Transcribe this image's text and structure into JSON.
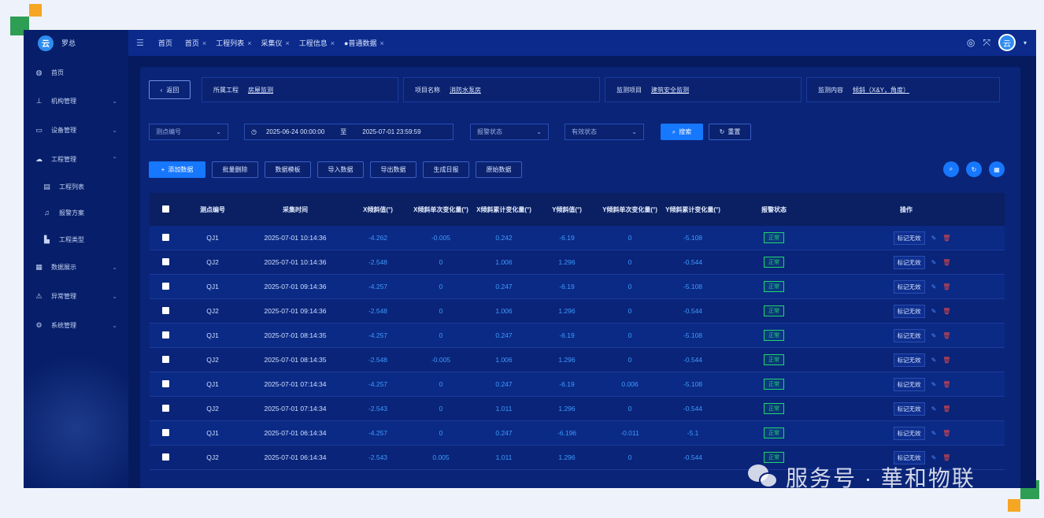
{
  "app": {
    "user": "罗总",
    "logo_text": "云"
  },
  "sidebar": {
    "items": [
      {
        "label": "首页",
        "icon": "dashboard-icon",
        "glyph": "◍",
        "chev": ""
      },
      {
        "label": "机构管理",
        "icon": "org-icon",
        "glyph": "⊥",
        "chev": "⌄"
      },
      {
        "label": "设备管理",
        "icon": "monitor-icon",
        "glyph": "▭",
        "chev": "⌄"
      },
      {
        "label": "工程管理",
        "icon": "cloud-icon",
        "glyph": "☁",
        "chev": "⌃"
      },
      {
        "label": "工程列表",
        "icon": "list-icon",
        "glyph": "▤",
        "chev": ""
      },
      {
        "label": "报警方案",
        "icon": "bell-icon",
        "glyph": "♫",
        "chev": ""
      },
      {
        "label": "工程类型",
        "icon": "building-icon",
        "glyph": "▙",
        "chev": ""
      },
      {
        "label": "数据展示",
        "icon": "table-icon",
        "glyph": "▦",
        "chev": "⌄"
      },
      {
        "label": "异常管理",
        "icon": "warning-icon",
        "glyph": "⚠",
        "chev": "⌄"
      },
      {
        "label": "系统管理",
        "icon": "gear-icon",
        "glyph": "⚙",
        "chev": "⌄"
      }
    ]
  },
  "topbar": {
    "tabs": [
      {
        "label": "首页",
        "close": ""
      },
      {
        "label": "首页",
        "close": "×"
      },
      {
        "label": "工程列表",
        "close": "×"
      },
      {
        "label": "采集仪",
        "close": "×"
      },
      {
        "label": "工程信息",
        "close": "×"
      },
      {
        "label": "●普通数据",
        "close": "×"
      }
    ]
  },
  "info": {
    "back": "返回",
    "project_label": "所属工程",
    "project_value": "房屋监测",
    "item_label": "项目名称",
    "item_value": "消防水泵房",
    "monitor_label": "监测项目",
    "monitor_value": "建筑安全监测",
    "content_label": "监测内容",
    "content_value": "倾斜（X&Y，角度）"
  },
  "filters": {
    "point_placeholder": "测点编号",
    "date_start": "2025-06-24 00:00:00",
    "date_sep": "至",
    "date_end": "2025-07-01 23:59:59",
    "alarm_placeholder": "报警状态",
    "valid_placeholder": "有效状态",
    "search": "搜索",
    "reset": "重置"
  },
  "actions": {
    "add": "添加数据",
    "batch_delete": "批量删除",
    "template": "数据模板",
    "import": "导入数据",
    "export": "导出数据",
    "daily": "生成日报",
    "raw": "原始数据"
  },
  "table": {
    "headers": {
      "point": "测点编号",
      "time": "采集时间",
      "x": "X倾斜值(°)",
      "x_single": "X倾斜单次变化量(°)",
      "x_total": "X倾斜累计变化量(°)",
      "y": "Y倾斜值(°)",
      "y_single": "Y倾斜单次变化量(°)",
      "y_total": "Y倾斜累计变化量(°)",
      "alarm": "报警状态",
      "ops": "操作"
    },
    "status_text": "正常",
    "mark_invalid": "标记无效",
    "rows": [
      {
        "point": "QJ1",
        "time": "2025-07-01 10:14:36",
        "x": "-4.262",
        "xs": "-0.005",
        "xt": "0.242",
        "y": "-6.19",
        "ys": "0",
        "yt": "-5.108"
      },
      {
        "point": "QJ2",
        "time": "2025-07-01 10:14:36",
        "x": "-2.548",
        "xs": "0",
        "xt": "1.006",
        "y": "1.296",
        "ys": "0",
        "yt": "-0.544"
      },
      {
        "point": "QJ1",
        "time": "2025-07-01 09:14:36",
        "x": "-4.257",
        "xs": "0",
        "xt": "0.247",
        "y": "-6.19",
        "ys": "0",
        "yt": "-5.108"
      },
      {
        "point": "QJ2",
        "time": "2025-07-01 09:14:36",
        "x": "-2.548",
        "xs": "0",
        "xt": "1.006",
        "y": "1.296",
        "ys": "0",
        "yt": "-0.544"
      },
      {
        "point": "QJ1",
        "time": "2025-07-01 08:14:35",
        "x": "-4.257",
        "xs": "0",
        "xt": "0.247",
        "y": "-6.19",
        "ys": "0",
        "yt": "-5.108"
      },
      {
        "point": "QJ2",
        "time": "2025-07-01 08:14:35",
        "x": "-2.548",
        "xs": "-0.005",
        "xt": "1.006",
        "y": "1.296",
        "ys": "0",
        "yt": "-0.544"
      },
      {
        "point": "QJ1",
        "time": "2025-07-01 07:14:34",
        "x": "-4.257",
        "xs": "0",
        "xt": "0.247",
        "y": "-6.19",
        "ys": "0.006",
        "yt": "-5.108"
      },
      {
        "point": "QJ2",
        "time": "2025-07-01 07:14:34",
        "x": "-2.543",
        "xs": "0",
        "xt": "1.011",
        "y": "1.296",
        "ys": "0",
        "yt": "-0.544"
      },
      {
        "point": "QJ1",
        "time": "2025-07-01 06:14:34",
        "x": "-4.257",
        "xs": "0",
        "xt": "0.247",
        "y": "-6.196",
        "ys": "-0.011",
        "yt": "-5.1"
      },
      {
        "point": "QJ2",
        "time": "2025-07-01 06:14:34",
        "x": "-2.543",
        "xs": "0.005",
        "xt": "1.011",
        "y": "1.296",
        "ys": "0",
        "yt": "-0.544"
      }
    ]
  },
  "watermark": {
    "text": "服务号 · 華和物联"
  },
  "colors": {
    "bg": "#061a5e",
    "accent": "#1677ff",
    "ok": "#1fd66f",
    "danger": "#e64a4a",
    "value": "#3d9bff"
  }
}
